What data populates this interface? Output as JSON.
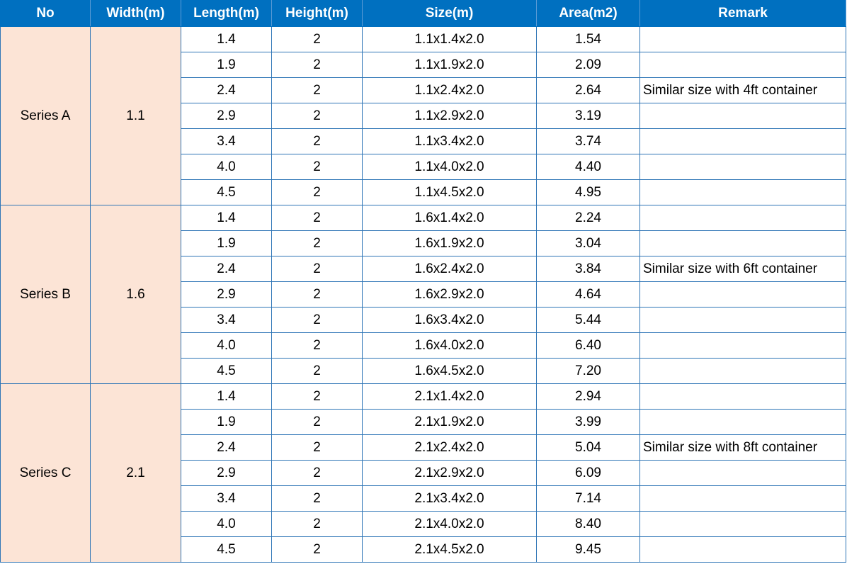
{
  "columns": [
    "No",
    "Width(m)",
    "Length(m)",
    "Height(m)",
    "Size(m)",
    "Area(m2)",
    "Remark"
  ],
  "series": [
    {
      "name": "Series A",
      "width": "1.1",
      "rows": [
        {
          "length": "1.4",
          "height": "2",
          "size": "1.1x1.4x2.0",
          "area": "1.54",
          "remark": ""
        },
        {
          "length": "1.9",
          "height": "2",
          "size": "1.1x1.9x2.0",
          "area": "2.09",
          "remark": ""
        },
        {
          "length": "2.4",
          "height": "2",
          "size": "1.1x2.4x2.0",
          "area": "2.64",
          "remark": "Similar size with 4ft container"
        },
        {
          "length": "2.9",
          "height": "2",
          "size": "1.1x2.9x2.0",
          "area": "3.19",
          "remark": ""
        },
        {
          "length": "3.4",
          "height": "2",
          "size": "1.1x3.4x2.0",
          "area": "3.74",
          "remark": ""
        },
        {
          "length": "4.0",
          "height": "2",
          "size": "1.1x4.0x2.0",
          "area": "4.40",
          "remark": ""
        },
        {
          "length": "4.5",
          "height": "2",
          "size": "1.1x4.5x2.0",
          "area": "4.95",
          "remark": ""
        }
      ]
    },
    {
      "name": "Series B",
      "width": "1.6",
      "rows": [
        {
          "length": "1.4",
          "height": "2",
          "size": "1.6x1.4x2.0",
          "area": "2.24",
          "remark": ""
        },
        {
          "length": "1.9",
          "height": "2",
          "size": "1.6x1.9x2.0",
          "area": "3.04",
          "remark": ""
        },
        {
          "length": "2.4",
          "height": "2",
          "size": "1.6x2.4x2.0",
          "area": "3.84",
          "remark": "Similar size with 6ft container"
        },
        {
          "length": "2.9",
          "height": "2",
          "size": "1.6x2.9x2.0",
          "area": "4.64",
          "remark": ""
        },
        {
          "length": "3.4",
          "height": "2",
          "size": "1.6x3.4x2.0",
          "area": "5.44",
          "remark": ""
        },
        {
          "length": "4.0",
          "height": "2",
          "size": "1.6x4.0x2.0",
          "area": "6.40",
          "remark": ""
        },
        {
          "length": "4.5",
          "height": "2",
          "size": "1.6x4.5x2.0",
          "area": "7.20",
          "remark": ""
        }
      ]
    },
    {
      "name": "Series C",
      "width": "2.1",
      "rows": [
        {
          "length": "1.4",
          "height": "2",
          "size": "2.1x1.4x2.0",
          "area": "2.94",
          "remark": ""
        },
        {
          "length": "1.9",
          "height": "2",
          "size": "2.1x1.9x2.0",
          "area": "3.99",
          "remark": ""
        },
        {
          "length": "2.4",
          "height": "2",
          "size": "2.1x2.4x2.0",
          "area": "5.04",
          "remark": "Similar size with 8ft container"
        },
        {
          "length": "2.9",
          "height": "2",
          "size": "2.1x2.9x2.0",
          "area": "6.09",
          "remark": ""
        },
        {
          "length": "3.4",
          "height": "2",
          "size": "2.1x3.4x2.0",
          "area": "7.14",
          "remark": ""
        },
        {
          "length": "4.0",
          "height": "2",
          "size": "2.1x4.0x2.0",
          "area": "8.40",
          "remark": ""
        },
        {
          "length": "4.5",
          "height": "2",
          "size": "2.1x4.5x2.0",
          "area": "9.45",
          "remark": ""
        }
      ]
    }
  ]
}
